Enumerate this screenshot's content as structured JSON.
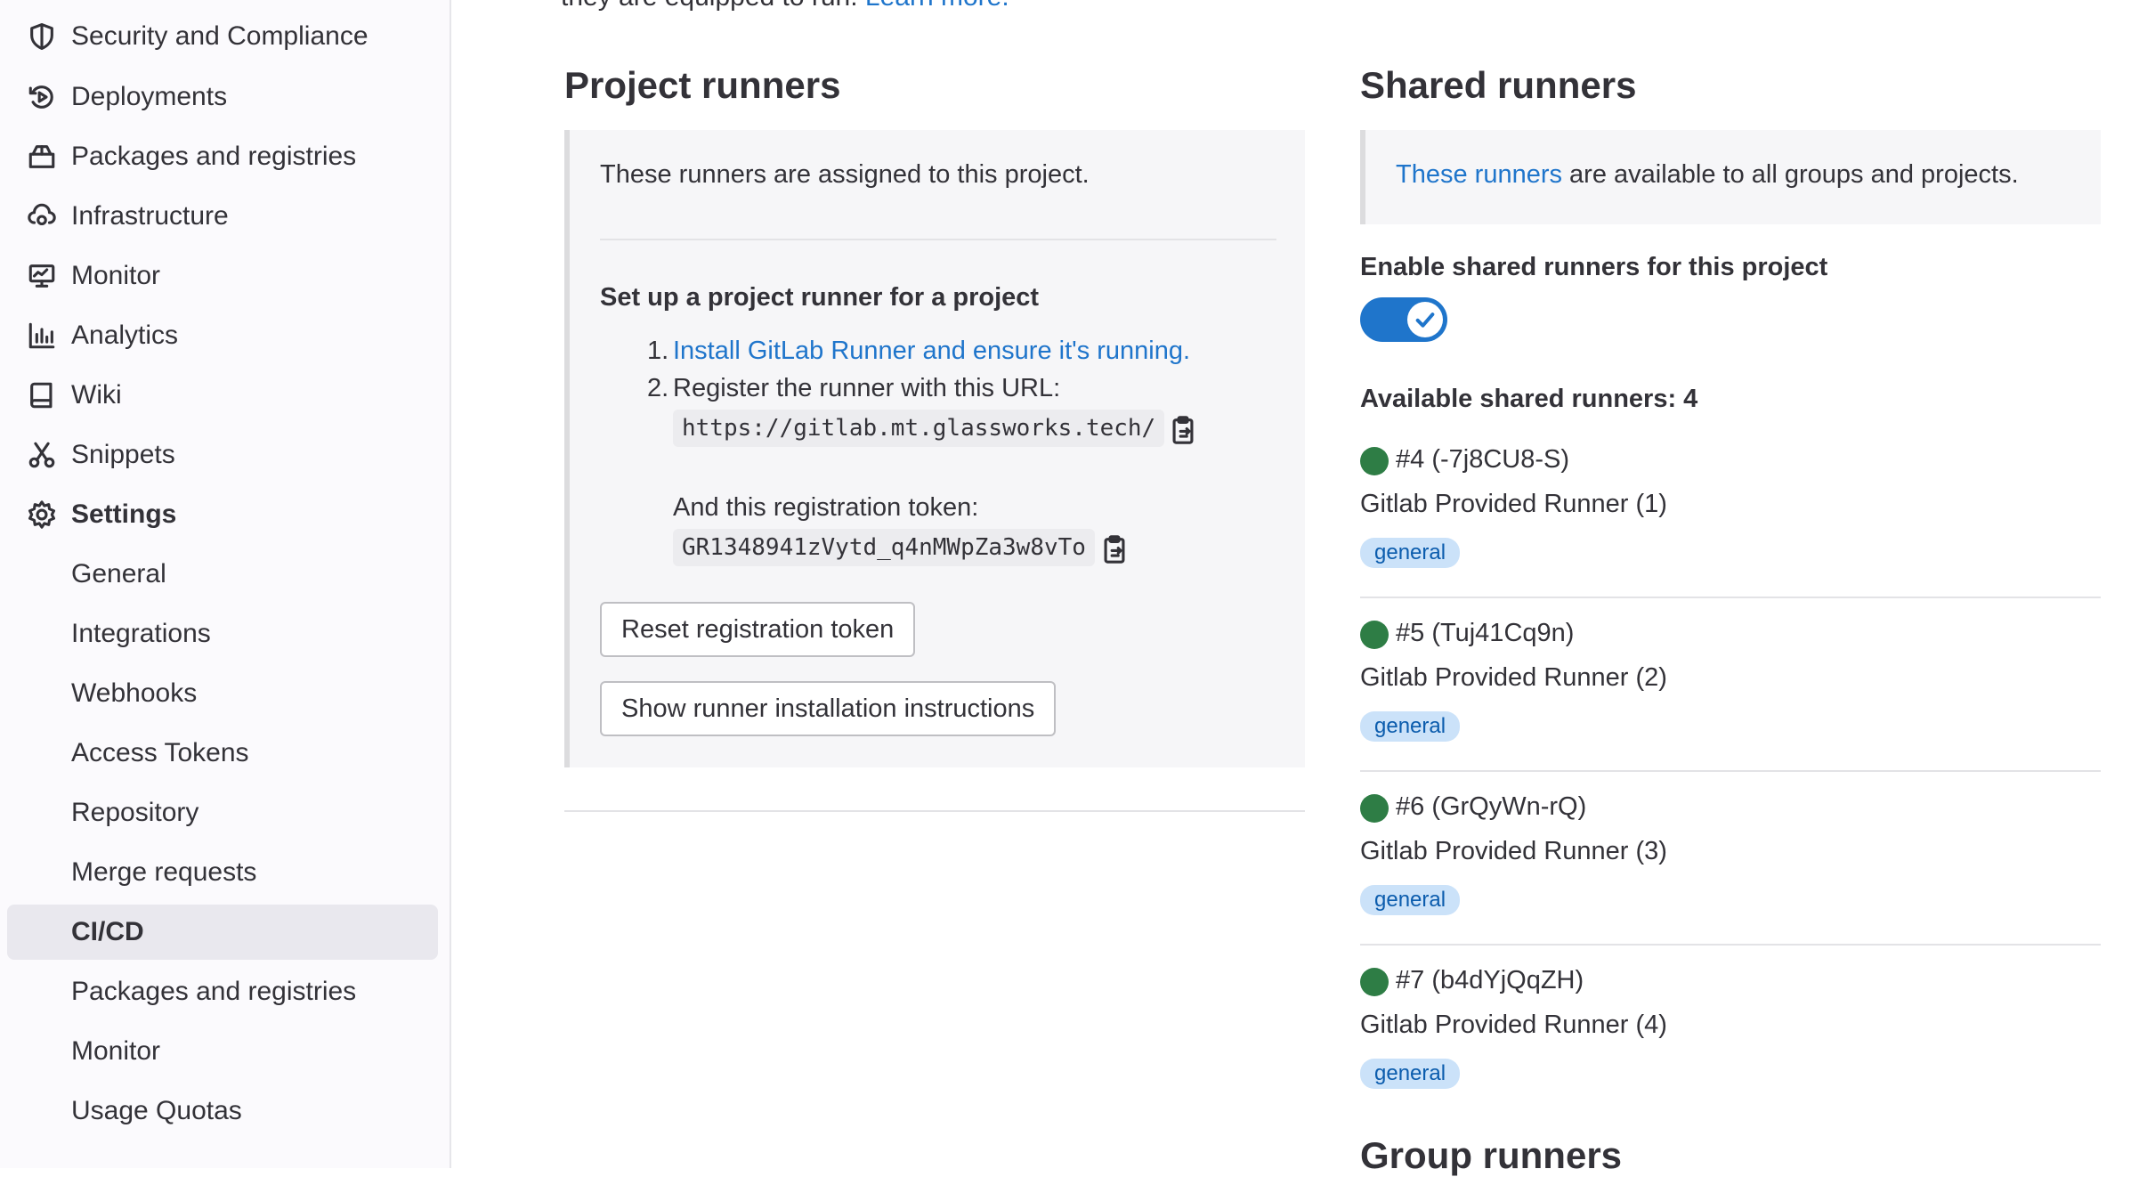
{
  "sidebar": {
    "items": [
      {
        "label": "Security and Compliance",
        "icon": "shield-icon"
      },
      {
        "label": "Deployments",
        "icon": "rocket-icon"
      },
      {
        "label": "Packages and registries",
        "icon": "package-icon"
      },
      {
        "label": "Infrastructure",
        "icon": "cloud-gear-icon"
      },
      {
        "label": "Monitor",
        "icon": "monitor-icon"
      },
      {
        "label": "Analytics",
        "icon": "chart-icon"
      },
      {
        "label": "Wiki",
        "icon": "book-icon"
      },
      {
        "label": "Snippets",
        "icon": "scissors-icon"
      },
      {
        "label": "Settings",
        "icon": "gear-icon"
      }
    ],
    "sub_items": [
      "General",
      "Integrations",
      "Webhooks",
      "Access Tokens",
      "Repository",
      "Merge requests",
      "CI/CD",
      "Packages and registries",
      "Monitor",
      "Usage Quotas"
    ],
    "active_sub_item": "CI/CD"
  },
  "main": {
    "top_text": "they are equipped to run.",
    "top_link": "Learn more.",
    "project_runners": {
      "title": "Project runners",
      "assigned_text": "These runners are assigned to this project.",
      "setup_title": "Set up a project runner for a project",
      "step1_num": "1.",
      "step1_link": "Install GitLab Runner and ensure it's running.",
      "step2_num": "2.",
      "step2_text": "Register the runner with this URL:",
      "url": "https://gitlab.mt.glassworks.tech/",
      "token_label": "And this registration token:",
      "token": "GR1348941zVytd_q4nMWpZa3w8vTo",
      "reset_button": "Reset registration token",
      "instructions_button": "Show runner installation instructions"
    },
    "shared_runners": {
      "title": "Shared runners",
      "info_link": "These runners",
      "info_text": " are available to all groups and projects.",
      "enable_label": "Enable shared runners for this project",
      "toggle_on": true,
      "available_label": "Available shared runners: 4",
      "runners": [
        {
          "id": "#4 (-7j8CU8-S)",
          "name": "Gitlab Provided Runner (1)",
          "tag": "general"
        },
        {
          "id": "#5 (Tuj41Cq9n)",
          "name": "Gitlab Provided Runner (2)",
          "tag": "general"
        },
        {
          "id": "#6 (GrQyWn-rQ)",
          "name": "Gitlab Provided Runner (3)",
          "tag": "general"
        },
        {
          "id": "#7 (b4dYjQqZH)",
          "name": "Gitlab Provided Runner (4)",
          "tag": "general"
        }
      ]
    },
    "group_runners": {
      "title": "Group runners"
    }
  },
  "colors": {
    "link": "#1f75cb",
    "online_dot": "#2e7d45",
    "toggle": "#1f75cb",
    "badge_bg": "#cbe2f9"
  }
}
